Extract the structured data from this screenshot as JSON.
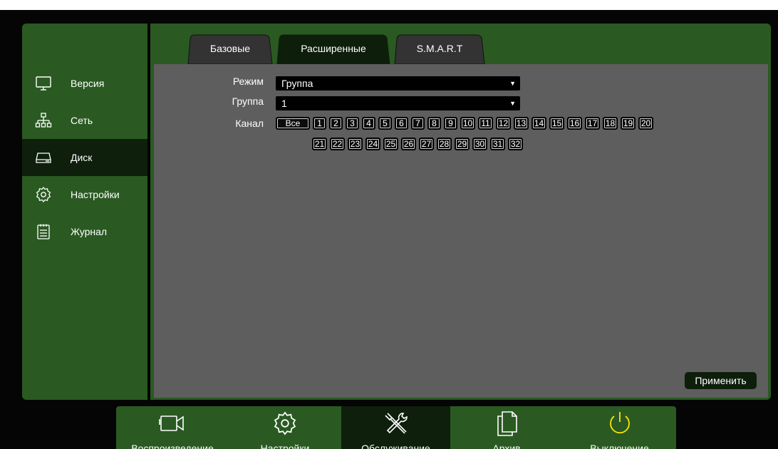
{
  "sidebar": {
    "items": [
      {
        "label": "Версия",
        "icon": "monitor-icon"
      },
      {
        "label": "Сеть",
        "icon": "network-icon"
      },
      {
        "label": "Диск",
        "icon": "disk-icon",
        "active": true
      },
      {
        "label": "Настройки",
        "icon": "gear-icon"
      },
      {
        "label": "Журнал",
        "icon": "log-icon"
      }
    ]
  },
  "tabs": [
    {
      "label": "Базовые"
    },
    {
      "label": "Расширенные",
      "active": true
    },
    {
      "label": "S.M.A.R.T"
    }
  ],
  "form": {
    "mode_label": "Режим",
    "mode_value": "Группа",
    "group_label": "Группа",
    "group_value": "1",
    "channel_label": "Канал",
    "channels": [
      "Все",
      "1",
      "2",
      "3",
      "4",
      "5",
      "6",
      "7",
      "8",
      "9",
      "10",
      "11",
      "12",
      "13",
      "14",
      "15",
      "16",
      "17",
      "18",
      "19",
      "20",
      "21",
      "22",
      "23",
      "24",
      "25",
      "26",
      "27",
      "28",
      "29",
      "30",
      "31",
      "32"
    ]
  },
  "apply_label": "Применить",
  "bottom": {
    "items": [
      {
        "label": "Воспроизведение",
        "icon": "camera-icon"
      },
      {
        "label": "Настройки",
        "icon": "gear-icon"
      },
      {
        "label": "Обслуживание",
        "icon": "tools-icon",
        "active": true
      },
      {
        "label": "Архив",
        "icon": "files-icon"
      },
      {
        "label": "Выключение",
        "icon": "power-icon"
      }
    ]
  },
  "colors": {
    "panel_green": "#2a5a22",
    "active_dark": "#0e1f0c",
    "content_gray": "#5e5e5e",
    "power_yellow": "#ffe600"
  }
}
